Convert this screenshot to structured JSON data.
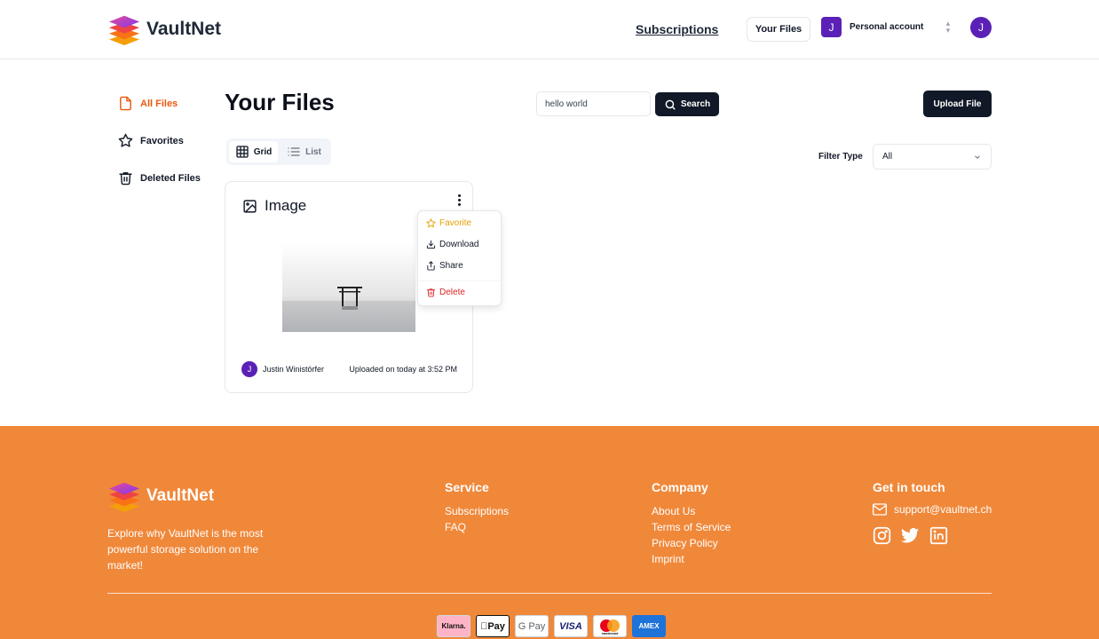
{
  "header": {
    "brand": "VaultNet",
    "nav_subscriptions": "Subscriptions",
    "your_files_button": "Your Files",
    "account_initial": "J",
    "account_label": "Personal account",
    "avatar_initial": "J"
  },
  "sidebar": {
    "items": [
      {
        "label": "All Files",
        "icon": "file-icon",
        "active": true
      },
      {
        "label": "Favorites",
        "icon": "star-icon",
        "active": false
      },
      {
        "label": "Deleted Files",
        "icon": "trash-icon",
        "active": false
      }
    ]
  },
  "main": {
    "title": "Your Files",
    "search_value": "hello world",
    "search_button": "Search",
    "upload_button": "Upload File",
    "view_toggle": [
      "Grid",
      "List"
    ],
    "active_view": "Grid",
    "filter_label": "Filter Type",
    "filter_value": "All"
  },
  "card": {
    "type_label": "Image",
    "uploader_initial": "J",
    "uploader": "Justin Winistörfer",
    "uploaded": "Uploaded on today at 3:52 PM"
  },
  "menu": {
    "favorite": "Favorite",
    "download": "Download",
    "share": "Share",
    "delete": "Delete"
  },
  "footer": {
    "brand": "VaultNet",
    "tagline": "Explore why VaultNet is the most powerful storage solution on the market!",
    "service_heading": "Service",
    "service_links": [
      "Subscriptions",
      "FAQ"
    ],
    "company_heading": "Company",
    "company_links": [
      "About Us",
      "Terms of Service",
      "Privacy Policy",
      "Imprint"
    ],
    "contact_heading": "Get in touch",
    "email": "support@vaultnet.ch",
    "payments": [
      "Klarna.",
      "Pay",
      "G Pay",
      "VISA",
      "mastercard",
      "AMEX"
    ]
  },
  "colors": {
    "accent": "#ea580c",
    "footer_bg": "#f0883a",
    "primary_button": "#111827",
    "avatar": "#5b21b6",
    "favorite": "#e3a008",
    "delete": "#dc2626"
  }
}
